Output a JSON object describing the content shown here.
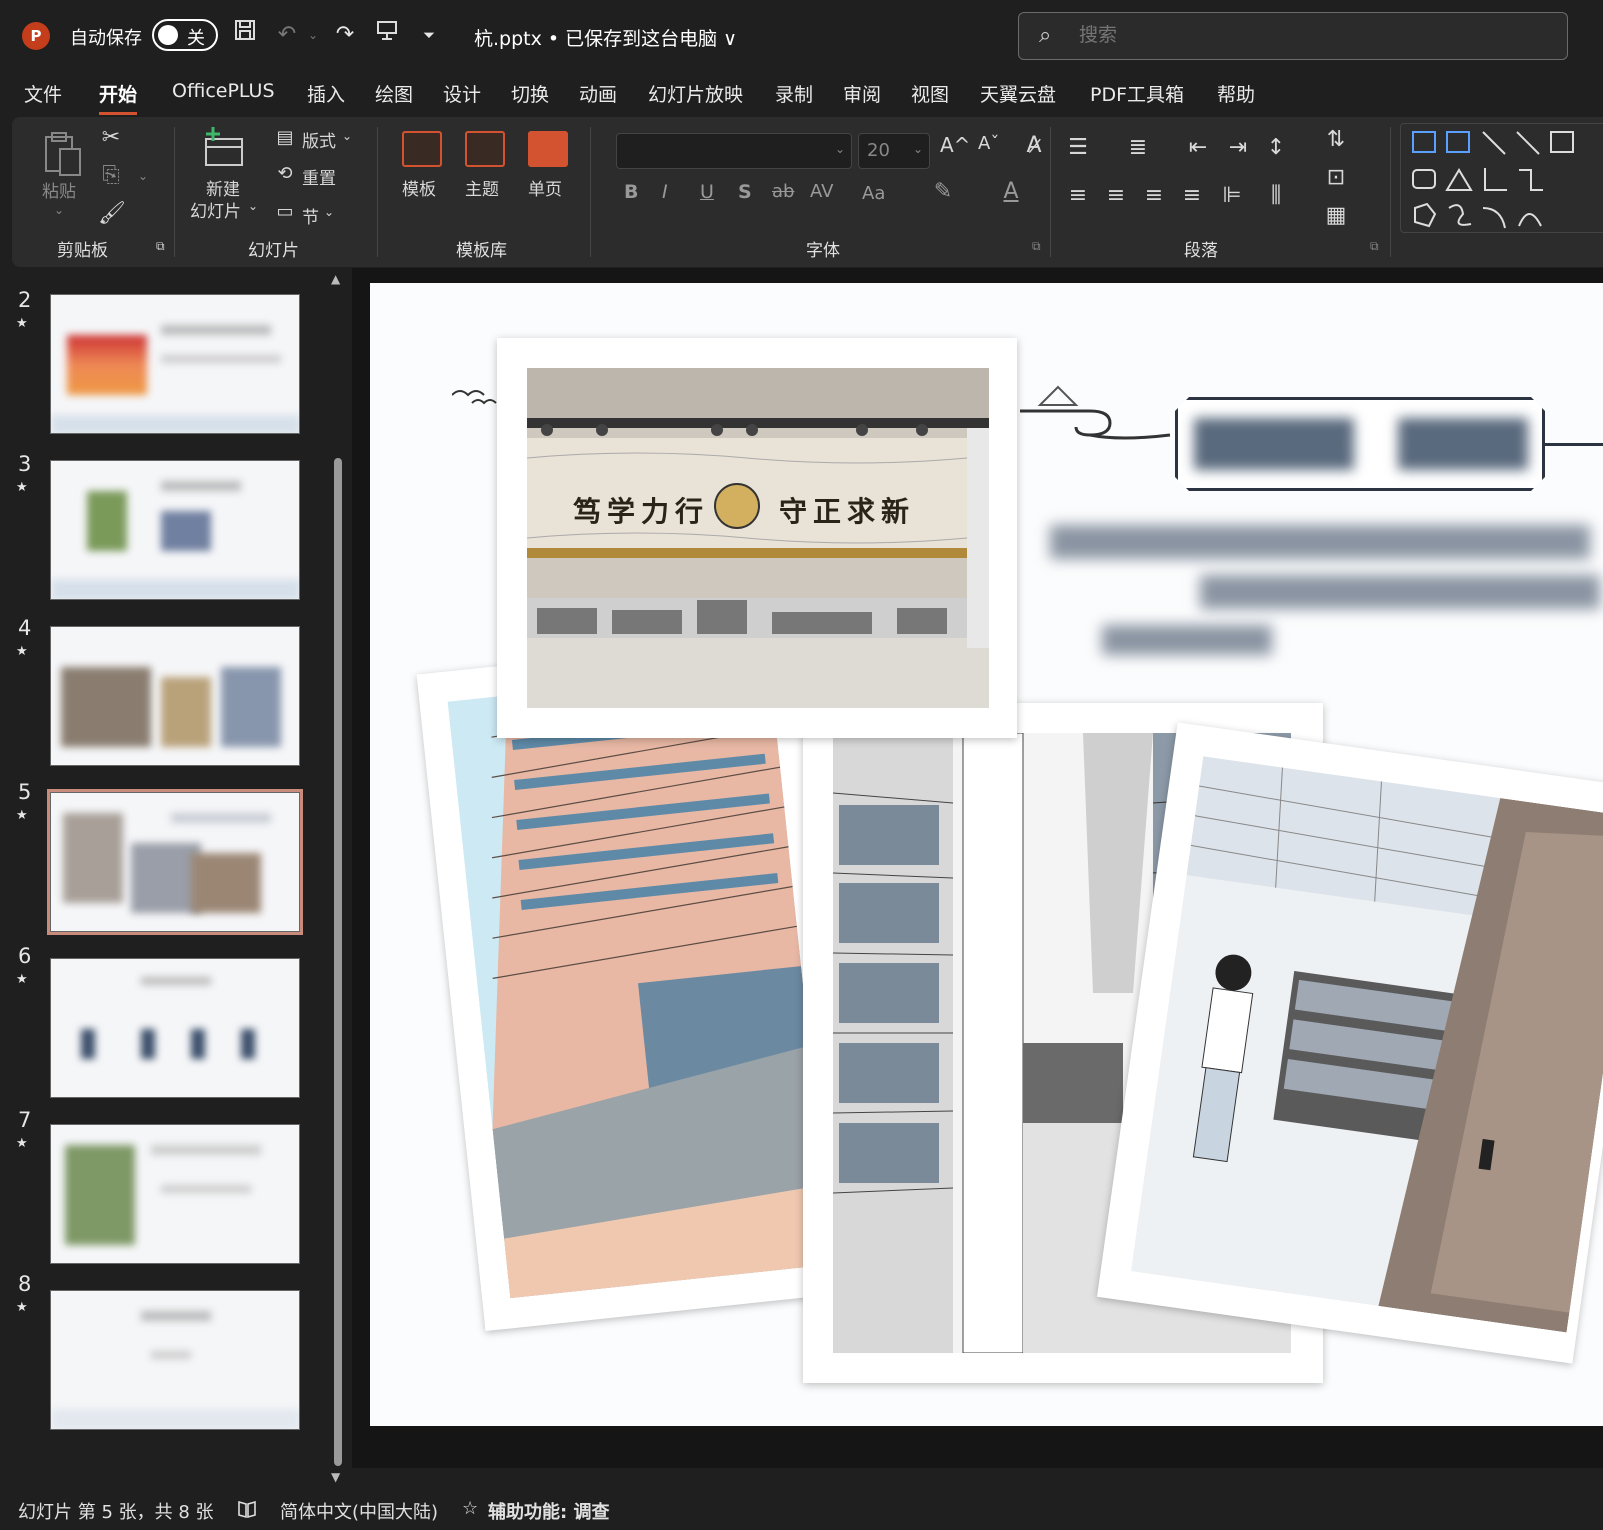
{
  "app": {
    "logo_letter": "P",
    "autosave_label": "自动保存",
    "autosave_state": "关"
  },
  "document": {
    "title": "杭.pptx • 已保存到这台电脑 ∨"
  },
  "search": {
    "placeholder": "搜索"
  },
  "menu": {
    "tabs": [
      "文件",
      "开始",
      "OfficePLUS",
      "插入",
      "绘图",
      "设计",
      "切换",
      "动画",
      "幻灯片放映",
      "录制",
      "审阅",
      "视图",
      "天翼云盘",
      "PDF工具箱",
      "帮助"
    ],
    "active": "开始"
  },
  "ribbon": {
    "clipboard": {
      "label": "剪贴板",
      "paste": "粘贴"
    },
    "slides": {
      "label": "幻灯片",
      "new_slide_line1": "新建",
      "new_slide_line2": "幻灯片",
      "layout": "版式",
      "reset": "重置",
      "section": "节"
    },
    "template_lib": {
      "label": "模板库",
      "template": "模板",
      "theme": "主题",
      "single_page": "单页"
    },
    "font": {
      "label": "字体",
      "font_size": "20",
      "bold": "B",
      "italic": "I",
      "underline": "U",
      "shadow": "S",
      "strike": "ab",
      "spacing": "AV",
      "case": "Aa",
      "grow": "A^",
      "shrink": "Aˇ"
    },
    "paragraph": {
      "label": "段落"
    }
  },
  "slides": [
    {
      "num": "2",
      "star": "★"
    },
    {
      "num": "3",
      "star": "★"
    },
    {
      "num": "4",
      "star": "★"
    },
    {
      "num": "5",
      "star": "★"
    },
    {
      "num": "6",
      "star": "★"
    },
    {
      "num": "7",
      "star": "★"
    },
    {
      "num": "8",
      "star": "★"
    }
  ],
  "selected_slide": "5",
  "slide_content": {
    "plaque_text_left": "笃学力行",
    "plaque_text_right": "守正求新"
  },
  "status": {
    "slide_info": "幻灯片 第 5 张，共 8 张",
    "language": "简体中文(中国大陆)",
    "accessibility": "辅助功能: 调查"
  }
}
